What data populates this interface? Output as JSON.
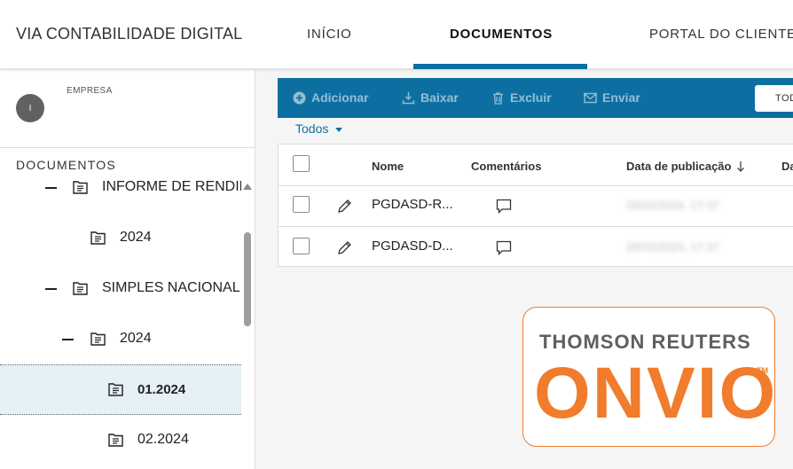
{
  "header": {
    "brand": "VIA CONTABILIDADE DIGITAL",
    "nav": [
      "INÍCIO",
      "DOCUMENTOS",
      "PORTAL DO CLIENTE"
    ],
    "active_nav": "DOCUMENTOS"
  },
  "sidebar": {
    "avatar_letter": "I",
    "company_label": "EMPRESA",
    "section_title": "DOCUMENTOS",
    "tree": [
      {
        "label": "INFORME DE RENDIMENTOS",
        "expanded": true
      },
      {
        "label": "2024"
      },
      {
        "label": "SIMPLES NACIONAL",
        "expanded": true
      },
      {
        "label": "2024",
        "expanded": true
      },
      {
        "label": "01.2024",
        "selected": true
      },
      {
        "label": "02.2024"
      }
    ]
  },
  "toolbar": {
    "add": "Adicionar",
    "download": "Baixar",
    "delete": "Excluir",
    "send": "Enviar",
    "dropdown": "TODOS"
  },
  "filter": {
    "label": "Todos"
  },
  "table": {
    "headers": {
      "name": "Nome",
      "comments": "Comentários",
      "published": "Data de publicação",
      "extra": "Da"
    },
    "rows": [
      {
        "name": "PGDASD-R...",
        "date": "29/02/2024, 17:37"
      },
      {
        "name": "PGDASD-D...",
        "date": "29/02/2024, 17:37"
      }
    ]
  },
  "logo": {
    "top": "THOMSON REUTERS",
    "main": "ONVIO",
    "tm": "TM"
  },
  "colors": {
    "accent": "#0d6fa1",
    "logo_orange": "#f07c2c",
    "selected_bg": "#e5f0f7"
  }
}
